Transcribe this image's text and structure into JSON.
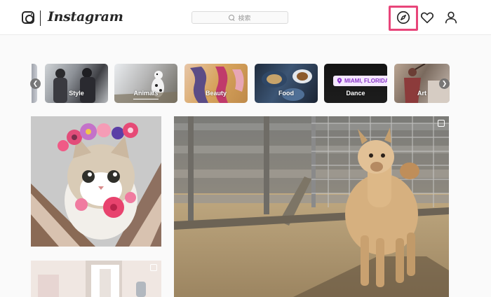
{
  "header": {
    "brand_name": "Instagram",
    "logo_icon": "instagram-camera-icon",
    "search": {
      "placeholder": "検索",
      "icon": "search-icon"
    },
    "nav_icons": [
      "compass-icon",
      "heart-icon",
      "user-icon"
    ],
    "highlight_color": "#e8457a"
  },
  "categories": [
    {
      "label": "Style"
    },
    {
      "label": "Animals"
    },
    {
      "label": "Beauty"
    },
    {
      "label": "Food"
    },
    {
      "label": "Dance",
      "location_tag": "MIAMI, FLORIDA"
    },
    {
      "label": "Art"
    }
  ],
  "grid": {
    "posts": [
      "cat-flower-crown-photo",
      "alpaca-photo",
      "room-photo"
    ],
    "multi_icon": "multiple-photos-icon"
  }
}
